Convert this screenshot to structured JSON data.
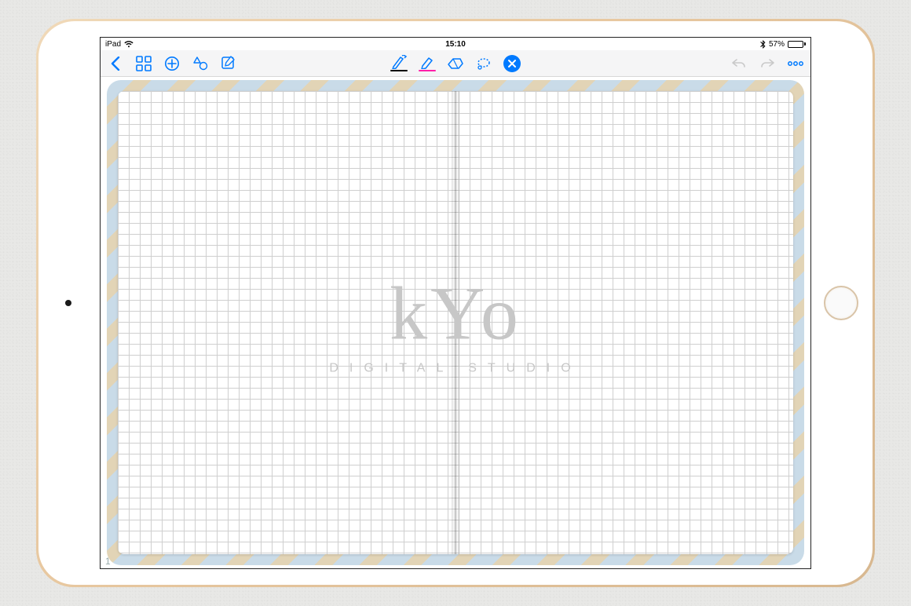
{
  "status": {
    "carrier": "iPad",
    "time": "15:10",
    "battery_percent": "57%"
  },
  "toolbar": {
    "pen_indicator_color": "#000000",
    "highlighter_indicator_color": "#ff1fa8"
  },
  "notebook": {
    "page_number": "1"
  },
  "watermark": {
    "title": "kYo",
    "subtitle": "DIGITAL STUDIO"
  }
}
